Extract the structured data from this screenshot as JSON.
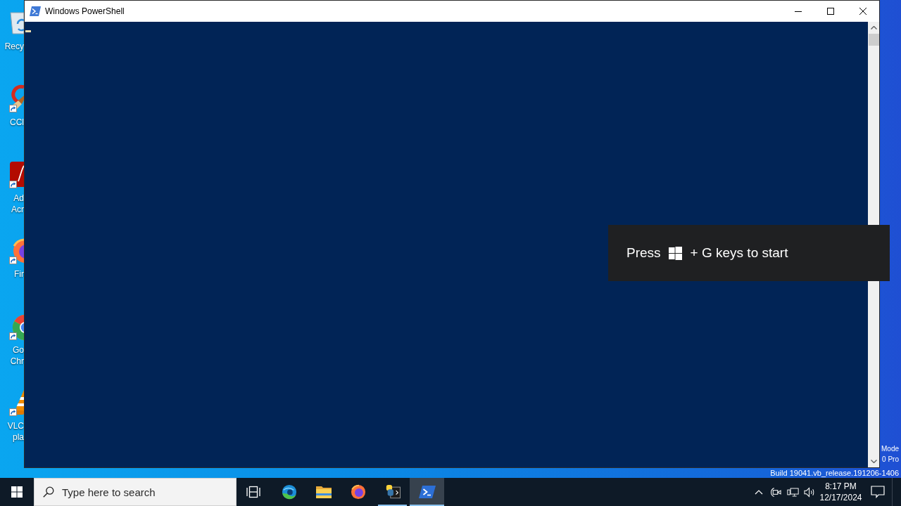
{
  "desktop": {
    "icons": [
      {
        "kind": "recyclebin",
        "shortcut": false,
        "label_lines": [
          "Recy"
        ]
      },
      {
        "kind": "brush",
        "shortcut": true,
        "label_lines": [
          "CCl"
        ]
      },
      {
        "kind": "reader",
        "shortcut": true,
        "label_lines": [
          "Ad",
          "Acr"
        ]
      },
      {
        "kind": "foxglobe",
        "shortcut": true,
        "label_lines": [
          "Fir"
        ]
      },
      {
        "kind": "ring",
        "shortcut": true,
        "label_lines": [
          "Go",
          "Chr"
        ]
      },
      {
        "kind": "cone",
        "shortcut": true,
        "label_lines": [
          "VLC",
          "pla"
        ]
      }
    ],
    "info_lines": [
      "Mode",
      "0 Pro"
    ],
    "build_line": "Build 19041.vb_release.191206-1406"
  },
  "window": {
    "title": "Windows PowerShell"
  },
  "game_bar_tip": {
    "before_key": "Press",
    "after_key": "+ G keys to start"
  },
  "taskbar": {
    "search": {
      "placeholder": "Type here to search"
    },
    "apps": [
      {
        "kind": "wave",
        "running": false,
        "selected": false
      },
      {
        "kind": "folder",
        "running": false,
        "selected": false
      },
      {
        "kind": "foxglobe",
        "running": false,
        "selected": false
      },
      {
        "kind": "scriptwindow",
        "running": true,
        "selected": false
      },
      {
        "kind": "prompt",
        "running": true,
        "selected": true
      }
    ],
    "clock": {
      "time": "8:17 PM",
      "date": "12/17/2024"
    }
  }
}
